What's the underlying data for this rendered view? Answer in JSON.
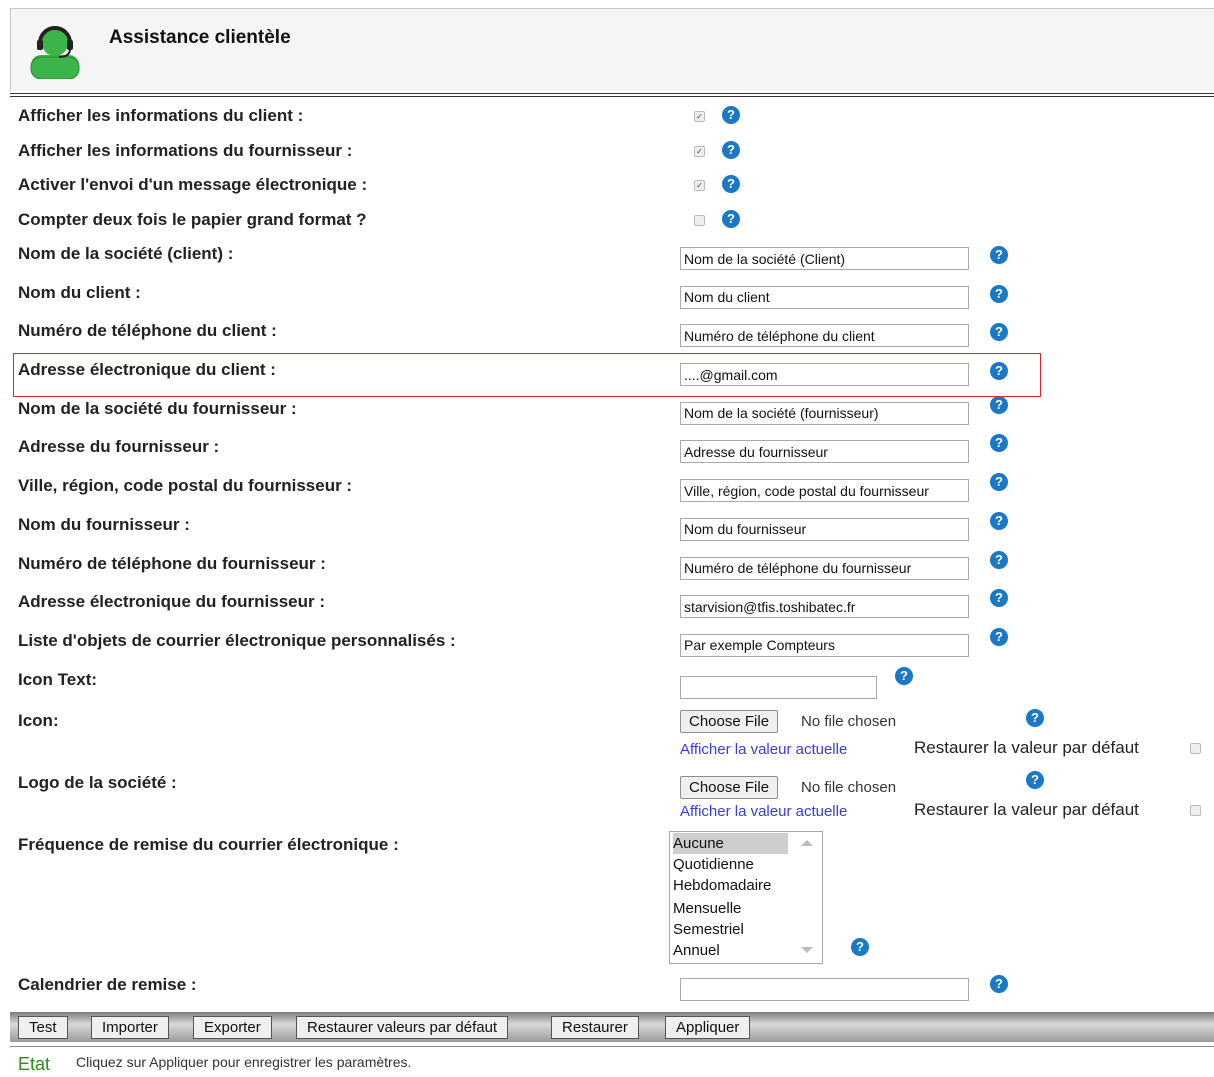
{
  "header": {
    "title": "Assistance clientèle"
  },
  "checkbox_rows": [
    {
      "label": "Afficher les informations du client :",
      "checked": true
    },
    {
      "label": "Afficher les informations du fournisseur :",
      "checked": true
    },
    {
      "label": "Activer l'envoi d'un message électronique :",
      "checked": true
    },
    {
      "label": "Compter deux fois le papier grand format ?",
      "checked": false
    }
  ],
  "text_rows": [
    {
      "label": "Nom de la société (client) :",
      "value": "Nom de la société (Client)"
    },
    {
      "label": "Nom du client :",
      "value": "Nom du client"
    },
    {
      "label": "Numéro de téléphone du client :",
      "value": "Numéro de téléphone du client"
    },
    {
      "label": "Adresse électronique du client :",
      "value": "....@gmail.com"
    },
    {
      "label": "Nom de la société du fournisseur :",
      "value": "Nom de la société (fournisseur)"
    },
    {
      "label": "Adresse du fournisseur :",
      "value": "Adresse du fournisseur"
    },
    {
      "label": "Ville, région, code postal du fournisseur :",
      "value": "Ville, région, code postal du fournisseur"
    },
    {
      "label": "Nom du fournisseur :",
      "value": "Nom du fournisseur"
    },
    {
      "label": "Numéro de téléphone du fournisseur :",
      "value": "Numéro de téléphone du fournisseur"
    },
    {
      "label": "Adresse électronique du fournisseur :",
      "value": "starvision@tfis.toshibatec.fr"
    },
    {
      "label": "Liste d'objets de courrier électronique personnalisés :",
      "value": "Par exemple Compteurs"
    }
  ],
  "icon_text": {
    "label": "Icon Text:",
    "value": ""
  },
  "icon_file": {
    "label": "Icon:",
    "button": "Choose File",
    "status": "No file chosen",
    "link": "Afficher la valeur actuelle",
    "restore": "Restaurer la valeur par défaut"
  },
  "logo_file": {
    "label": "Logo de la société :",
    "button": "Choose File",
    "status": "No file chosen",
    "link": "Afficher la valeur actuelle",
    "restore": "Restaurer la valeur par défaut"
  },
  "frequency": {
    "label": "Fréquence de remise du courrier électronique :",
    "options": [
      "Aucune",
      "Quotidienne",
      "Hebdomadaire",
      "Mensuelle",
      "Semestriel",
      "Annuel"
    ],
    "selected": "Aucune"
  },
  "calendar": {
    "label": "Calendrier de remise :",
    "value": ""
  },
  "toolbar": {
    "test": "Test",
    "import": "Importer",
    "export": "Exporter",
    "restore_defaults": "Restaurer valeurs par défaut",
    "restore": "Restaurer",
    "apply": "Appliquer"
  },
  "status": {
    "label": "Etat",
    "text": "Cliquez sur Appliquer pour enregistrer les paramètres."
  },
  "help_glyph": "?",
  "colors": {
    "help_icon": "#1a78c6",
    "highlight": "#d9232d",
    "avatar": "#3cb44a"
  }
}
